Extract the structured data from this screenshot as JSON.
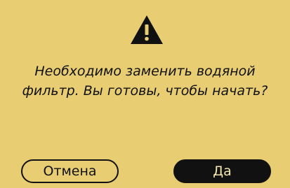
{
  "dialog": {
    "icon": "warning-triangle-icon",
    "message_line1": "Необходимо заменить водяной",
    "message_line2": "фильтр. Вы готовы, чтобы начать?",
    "cancel_label": "Отмена",
    "ok_label": "Да"
  },
  "colors": {
    "background": "#e8cd73",
    "text": "#111111",
    "primary_button": "#111111",
    "primary_button_text": "#f5e6b0"
  }
}
